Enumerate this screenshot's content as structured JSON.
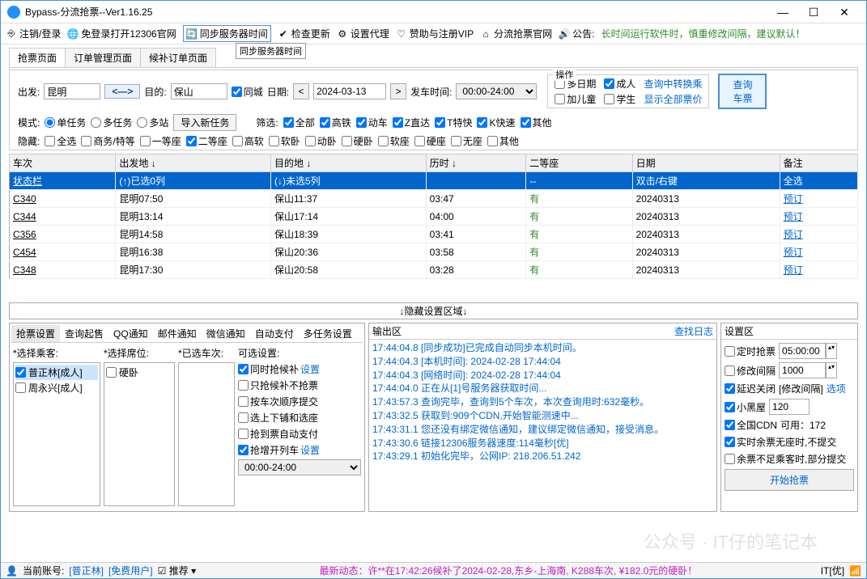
{
  "window": {
    "title": "Bypass-分流抢票--Ver1.16.25"
  },
  "toolbar": {
    "items": [
      "注销/登录",
      "免登录打开12306官网",
      "同步服务器时间",
      "检查更新",
      "设置代理",
      "赞助与注册VIP",
      "分流抢票官网",
      "公告:"
    ],
    "announce": "长时间运行软件时，慎重修改间隔，建议默认！",
    "tooltip": "同步服务器时间"
  },
  "tabs": [
    "抢票页面",
    "订单管理页面",
    "候补订单页面"
  ],
  "search": {
    "depart_lbl": "出发:",
    "depart": "昆明",
    "swap": "<—>",
    "dest_lbl": "目的:",
    "dest": "保山",
    "same_city_chk": "同城",
    "date_lbl": "日期:",
    "date": "2024-03-13",
    "time_lbl": "发车时间:",
    "time": "00:00-24:00"
  },
  "ops": {
    "title": "操作",
    "multi_date": "多日期",
    "adult": "成人",
    "trans": "查询中转换乘",
    "child": "加儿童",
    "student": "学生",
    "show_price": "显示全部票价",
    "query": "查询\n车票"
  },
  "mode": {
    "lbl": "模式:",
    "single": "单任务",
    "multi": "多任务",
    "station": "多站",
    "import": "导入新任务"
  },
  "filter": {
    "lbl": "筛选:",
    "all": "全部",
    "gt": "高铁",
    "dc": "动车",
    "zd": "Z直达",
    "tk": "T特快",
    "kk": "K快速",
    "other": "其他"
  },
  "hide": {
    "lbl": "隐藏:",
    "all": "全选",
    "sw": "商务/特等",
    "y1": "一等座",
    "y2": "二等座",
    "gr": "高软",
    "rw": "软卧",
    "dw": "动卧",
    "yw": "硬卧",
    "rz": "软座",
    "yz": "硬座",
    "wz": "无座",
    "other": "其他"
  },
  "table": {
    "headers": [
      "车次",
      "出发地 ↓",
      "目的地 ↓",
      "历时 ↓",
      "二等座",
      "日期",
      "备注"
    ],
    "status_row": [
      "状态栏",
      "(↑)已选0列",
      "(↓)未选5列",
      "",
      "--",
      "双击/右键",
      "全选"
    ],
    "rows": [
      [
        "C340",
        "昆明07:50",
        "保山11:37",
        "03:47",
        "有",
        "20240313",
        "预订"
      ],
      [
        "C344",
        "昆明13:14",
        "保山17:14",
        "04:00",
        "有",
        "20240313",
        "预订"
      ],
      [
        "C356",
        "昆明14:58",
        "保山18:39",
        "03:41",
        "有",
        "20240313",
        "预订"
      ],
      [
        "C454",
        "昆明16:38",
        "保山20:36",
        "03:58",
        "有",
        "20240313",
        "预订"
      ],
      [
        "C348",
        "昆明17:30",
        "保山20:58",
        "03:28",
        "有",
        "20240313",
        "预订"
      ]
    ]
  },
  "hide_bar": "↓隐藏设置区域↓",
  "bottom_tabs_left": [
    "抢票设置",
    "查询起售",
    "QQ通知",
    "邮件通知",
    "微信通知",
    "自动支付",
    "多任务设置"
  ],
  "passengers": {
    "lbl": "*选择乘客:",
    "items": [
      "普正林[成人]",
      "周永兴[成人]"
    ]
  },
  "seats": {
    "lbl": "*选择席位:",
    "items": [
      "硬卧"
    ]
  },
  "trains_sel": {
    "lbl": "*已选车次:"
  },
  "options": {
    "lbl": "可选设置:",
    "hb": "同时抢候补",
    "set": "设置",
    "only_hb": "只抢候补不抢票",
    "seq": "按车次顺序提交",
    "bunk": "选上下铺和选座",
    "auto_pay": "抢到票自动支付",
    "add_train": "抢增开列车",
    "time": "00:00-24:00"
  },
  "output": {
    "title": "输出区",
    "find_log": "查找日志",
    "lines": [
      "17:44:04.8 [同步成功]已完成自动同步本机时间。",
      "17:44:04.3 [本机时间]: 2024-02-28 17:44:04",
      "17:44:04.3 [网络时间]: 2024-02-28 17:44:04",
      "17:44:04.0 正在从[1]号服务器获取时间...",
      "17:43:57.3 查询完毕，查询到5个车次，本次查询用时:632毫秒。",
      "17:43:32.5 获取到:909个CDN,开始智能测速中...",
      "17:43:31.1 您还没有绑定微信通知，建议绑定微信通知，接受消息。",
      "17:43:30.6 链接12306服务器速度:114毫秒[优]",
      "17:43:29.1 初始化完毕，公网IP:  218.206.51.242"
    ]
  },
  "settings": {
    "title": "设置区",
    "timed": "定时抢票",
    "timed_val": "05:00:00",
    "interval": "修改间隔",
    "interval_val": "1000",
    "delay": "延迟关闭",
    "delay2": "[修改间隔]",
    "opts": "选项",
    "black": "小黑屋",
    "black_val": "120",
    "cdn": "全国CDN",
    "cdn_usable": "可用：172",
    "rt": "实时余票无座时,不提交",
    "insuf": "余票不足乘客时,部分提交",
    "start": "开始抢票"
  },
  "status": {
    "acct_lbl": "当前账号:",
    "acct": "[普正林]",
    "type": "[免费用户]",
    "recommend": "推荐 ▾",
    "latest": "最新动态：许**在17:42:26候补了2024-02-28,东乡-上海南, K288车次, ¥182.0元的硬卧！",
    "net": "IT[优]",
    "rssi": "📶"
  },
  "watermark": "公众号 · IT仔的笔记本"
}
